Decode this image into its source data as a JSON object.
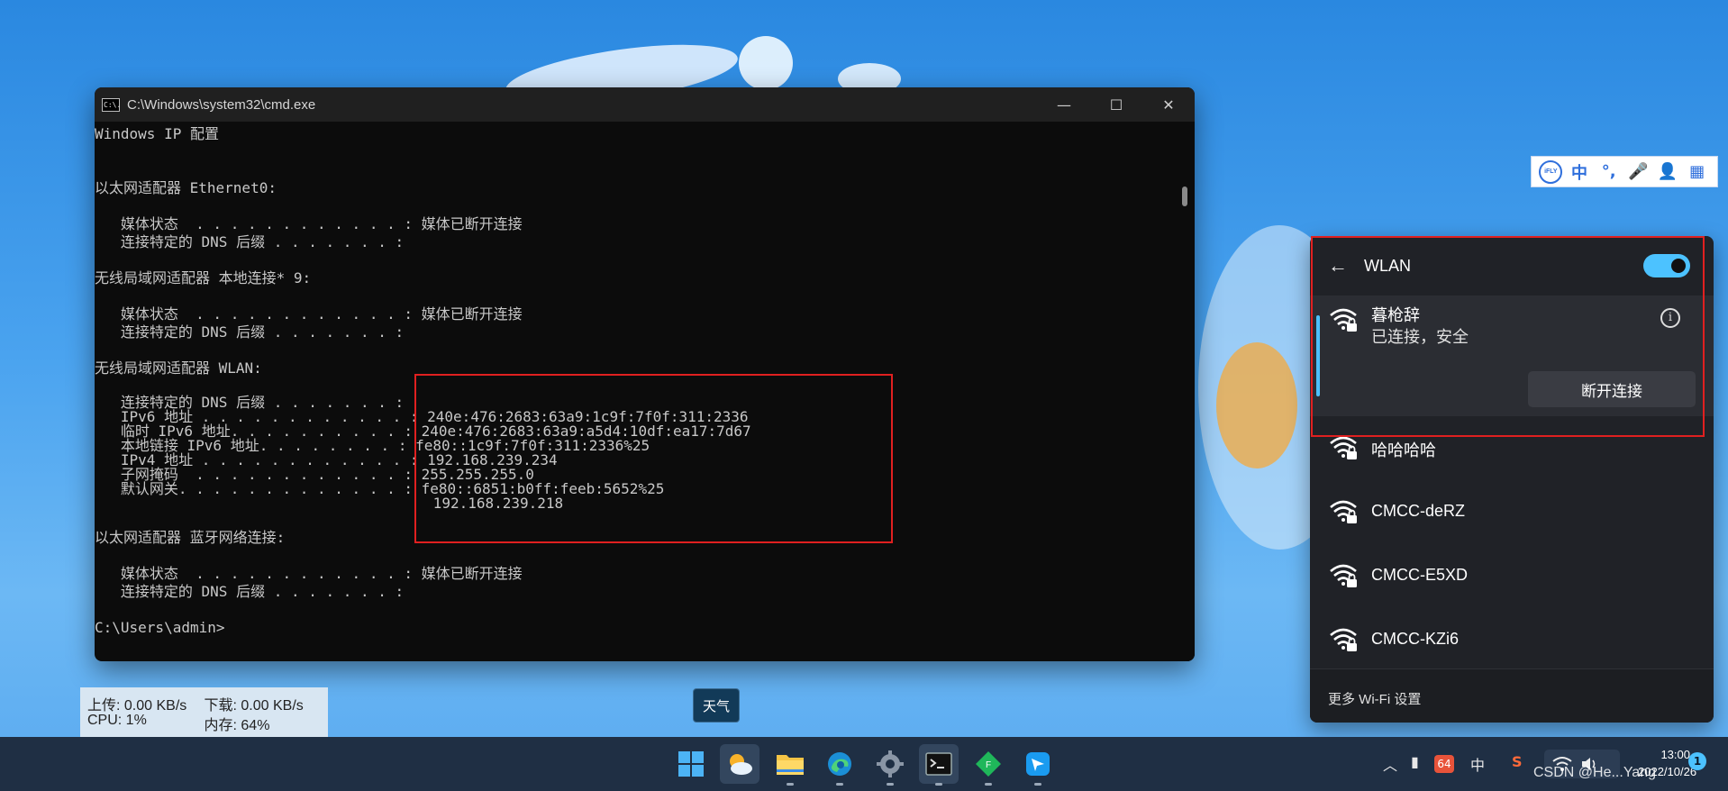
{
  "cmd": {
    "title": "C:\\Windows\\system32\\cmd.exe",
    "icon_text": "C:\\.",
    "controls": {
      "minimize": "—",
      "maximize": "☐",
      "close": "✕"
    },
    "lines": [
      "Windows IP 配置",
      "",
      "",
      "以太网适配器 Ethernet0:",
      "",
      "   媒体状态  . . . . . . . . . . . . : 媒体已断开连接",
      "   连接特定的 DNS 后缀 . . . . . . . :",
      "",
      "无线局域网适配器 本地连接* 9:",
      "",
      "   媒体状态  . . . . . . . . . . . . : 媒体已断开连接",
      "   连接特定的 DNS 后缀 . . . . . . . :",
      "",
      "无线局域网适配器 WLAN:",
      "",
      "   连接特定的 DNS 后缀 . . . . . . . :",
      "   IPv6 地址 . . . . . . . . . . . . : 240e:476:2683:63a9:1c9f:7f0f:311:2336",
      "   临时 IPv6 地址. . . . . . . . . . : 240e:476:2683:63a9:a5d4:10df:ea17:7d67",
      "   本地链接 IPv6 地址. . . . . . . . : fe80::1c9f:7f0f:311:2336%25",
      "   IPv4 地址 . . . . . . . . . . . . : 192.168.239.234",
      "   子网掩码  . . . . . . . . . . . . : 255.255.255.0",
      "   默认网关. . . . . . . . . . . . . : fe80::6851:b0ff:feeb:5652%25",
      "                                       192.168.239.218",
      "",
      "以太网适配器 蓝牙网络连接:",
      "",
      "   媒体状态  . . . . . . . . . . . . : 媒体已断开连接",
      "   连接特定的 DNS 后缀 . . . . . . . :",
      "",
      "C:\\Users\\admin>"
    ]
  },
  "ime": {
    "logo": "iFLY",
    "items": [
      "中",
      "°,",
      "🎤",
      "👤",
      "▦"
    ]
  },
  "wlan": {
    "back_icon": "←",
    "title": "WLAN",
    "toggle_on": true,
    "connected": {
      "name": "暮枪辞",
      "status": "已连接，安全",
      "info_icon": "i",
      "disconnect_label": "断开连接"
    },
    "networks": [
      {
        "name": "哈哈哈哈"
      },
      {
        "name": "CMCC-deRZ"
      },
      {
        "name": "CMCC-E5XD"
      },
      {
        "name": "CMCC-KZi6"
      }
    ],
    "more_settings": "更多 Wi-Fi 设置"
  },
  "speed_widget": {
    "upload": "上传: 0.00 KB/s",
    "download": "下载: 0.00 KB/s",
    "cpu": "CPU: 1%",
    "memory": "内存: 64%"
  },
  "weather_tooltip": "天气",
  "tray": {
    "chevron": "︿",
    "badge_64": "64",
    "lang": "中",
    "sogou": "S",
    "time": "13:00",
    "date": "2022/10/26",
    "notification_count": "1"
  },
  "watermark": "CSDN @He...Yang",
  "colors": {
    "accent": "#4cc2ff",
    "highlight_box": "#e02020",
    "console_bg": "#0c0c0c",
    "console_text": "#c8c8c8",
    "flyout_bg": "#202227"
  }
}
